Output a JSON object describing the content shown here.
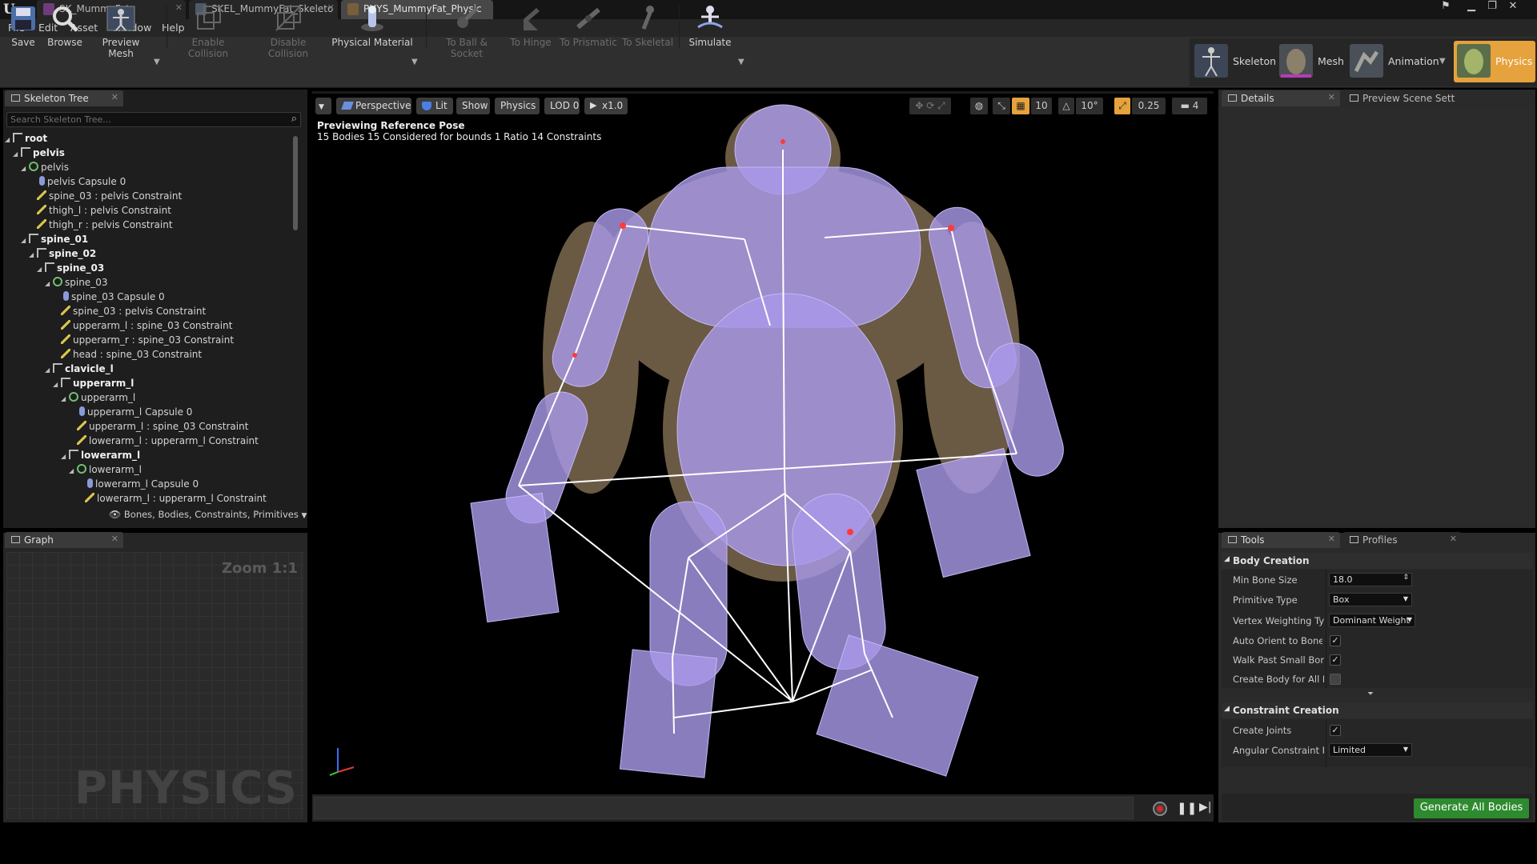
{
  "titlebar": {
    "tabs": [
      {
        "label": "SK_MummyFat"
      },
      {
        "label": "SKEL_MummyFat_Skeleto"
      },
      {
        "label": "PHYS_MummyFat_Physic"
      }
    ]
  },
  "menubar": {
    "items": [
      "File",
      "Edit",
      "Asset",
      "Window",
      "Help"
    ]
  },
  "toolbar": {
    "save": "Save",
    "browse": "Browse",
    "preview_mesh": "Preview Mesh",
    "enable_collision": "Enable Collision",
    "disable_collision": "Disable Collision",
    "physical_material": "Physical Material",
    "to_ball_socket": "To Ball & Socket",
    "to_hinge": "To Hinge",
    "to_prismatic": "To Prismatic",
    "to_skeletal": "To Skeletal",
    "simulate": "Simulate"
  },
  "modes": {
    "skeleton": "Skeleton",
    "mesh": "Mesh",
    "animation": "Animation",
    "physics": "Physics"
  },
  "skeleton_tree": {
    "tab": "Skeleton Tree",
    "search_placeholder": "Search Skeleton Tree...",
    "rows": [
      {
        "label": "root",
        "type": "bone",
        "indent": 0,
        "bold": true
      },
      {
        "label": "pelvis",
        "type": "bone",
        "indent": 1,
        "bold": true
      },
      {
        "label": "pelvis",
        "type": "body",
        "indent": 2,
        "bold": false
      },
      {
        "label": "pelvis Capsule 0",
        "type": "caps",
        "indent": 3,
        "bold": false
      },
      {
        "label": "spine_03 : pelvis Constraint",
        "type": "cons",
        "indent": 3,
        "bold": false
      },
      {
        "label": "thigh_l : pelvis Constraint",
        "type": "cons",
        "indent": 3,
        "bold": false
      },
      {
        "label": "thigh_r : pelvis Constraint",
        "type": "cons",
        "indent": 3,
        "bold": false
      },
      {
        "label": "spine_01",
        "type": "bone",
        "indent": 2,
        "bold": true
      },
      {
        "label": "spine_02",
        "type": "bone",
        "indent": 3,
        "bold": true
      },
      {
        "label": "spine_03",
        "type": "bone",
        "indent": 4,
        "bold": true
      },
      {
        "label": "spine_03",
        "type": "body",
        "indent": 5,
        "bold": false
      },
      {
        "label": "spine_03 Capsule 0",
        "type": "caps",
        "indent": 6,
        "bold": false
      },
      {
        "label": "spine_03 : pelvis Constraint",
        "type": "cons",
        "indent": 6,
        "bold": false
      },
      {
        "label": "upperarm_l : spine_03 Constraint",
        "type": "cons",
        "indent": 6,
        "bold": false
      },
      {
        "label": "upperarm_r : spine_03 Constraint",
        "type": "cons",
        "indent": 6,
        "bold": false
      },
      {
        "label": "head : spine_03 Constraint",
        "type": "cons",
        "indent": 6,
        "bold": false
      },
      {
        "label": "clavicle_l",
        "type": "bone",
        "indent": 5,
        "bold": true
      },
      {
        "label": "upperarm_l",
        "type": "bone",
        "indent": 6,
        "bold": true
      },
      {
        "label": "upperarm_l",
        "type": "body",
        "indent": 7,
        "bold": false
      },
      {
        "label": "upperarm_l Capsule 0",
        "type": "caps",
        "indent": 8,
        "bold": false
      },
      {
        "label": "upperarm_l : spine_03 Constraint",
        "type": "cons",
        "indent": 8,
        "bold": false
      },
      {
        "label": "lowerarm_l : upperarm_l Constraint",
        "type": "cons",
        "indent": 8,
        "bold": false
      },
      {
        "label": "lowerarm_l",
        "type": "bone",
        "indent": 7,
        "bold": true
      },
      {
        "label": "lowerarm_l",
        "type": "body",
        "indent": 8,
        "bold": false
      },
      {
        "label": "lowerarm_l Capsule 0",
        "type": "caps",
        "indent": 9,
        "bold": false
      },
      {
        "label": "lowerarm_l : upperarm_l Constraint",
        "type": "cons",
        "indent": 9,
        "bold": false
      }
    ],
    "filter": "Bones, Bodies, Constraints, Primitives"
  },
  "graph": {
    "tab": "Graph",
    "zoom": "Zoom 1:1",
    "watermark": "PHYSICS"
  },
  "viewport": {
    "perspective": "Perspective",
    "lit": "Lit",
    "show": "Show",
    "physics": "Physics",
    "lod": "LOD 0",
    "speed": "x1.0",
    "grid_size": "10",
    "rot_snap": "10°",
    "scale_snap": "0.25",
    "cam_speed": "4",
    "overlay_line1": "Previewing Reference Pose",
    "overlay_line2": "15 Bodies  15 Considered for bounds  1 Ratio  14 Constraints"
  },
  "details": {
    "tab1": "Details",
    "tab2": "Preview Scene Sett"
  },
  "tools": {
    "tab1": "Tools",
    "tab2": "Profiles",
    "body_creation": "Body Creation",
    "min_bone_size_label": "Min Bone Size",
    "min_bone_size": "18.0",
    "primitive_type_label": "Primitive Type",
    "primitive_type": "Box",
    "vertex_weighting_label": "Vertex Weighting Type",
    "vertex_weighting": "Dominant Weight",
    "auto_orient_label": "Auto Orient to Bone",
    "walk_past_label": "Walk Past Small Bones",
    "create_body_all_label": "Create Body for All Bon",
    "constraint_creation": "Constraint Creation",
    "create_joints_label": "Create Joints",
    "angular_constraint_label": "Angular Constraint Moc",
    "angular_constraint": "Limited",
    "generate": "Generate All Bodies"
  },
  "colors": {
    "accent_orange": "#e6a23c",
    "generate_green": "#2e8a2e",
    "physics_body": "#a898e8"
  }
}
